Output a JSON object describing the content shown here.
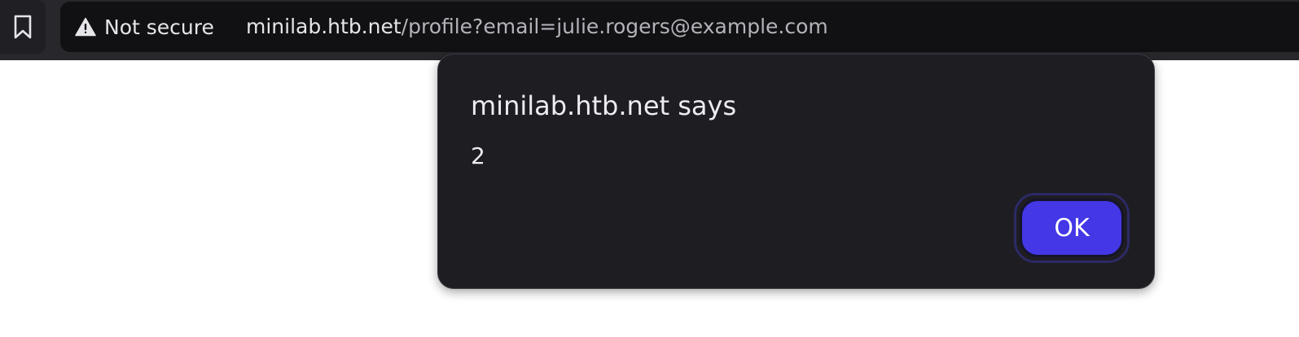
{
  "browser": {
    "security_label": "Not secure",
    "url_host": "minilab.htb.net",
    "url_path": "/profile?email=julie.rogers@example.com",
    "icons": {
      "bookmark": "bookmark-icon",
      "warning": "warning-triangle-icon"
    }
  },
  "dialog": {
    "title": "minilab.htb.net says",
    "message": "2",
    "ok_label": "OK",
    "colors": {
      "background": "#1e1d22",
      "button": "#4337e6"
    }
  }
}
